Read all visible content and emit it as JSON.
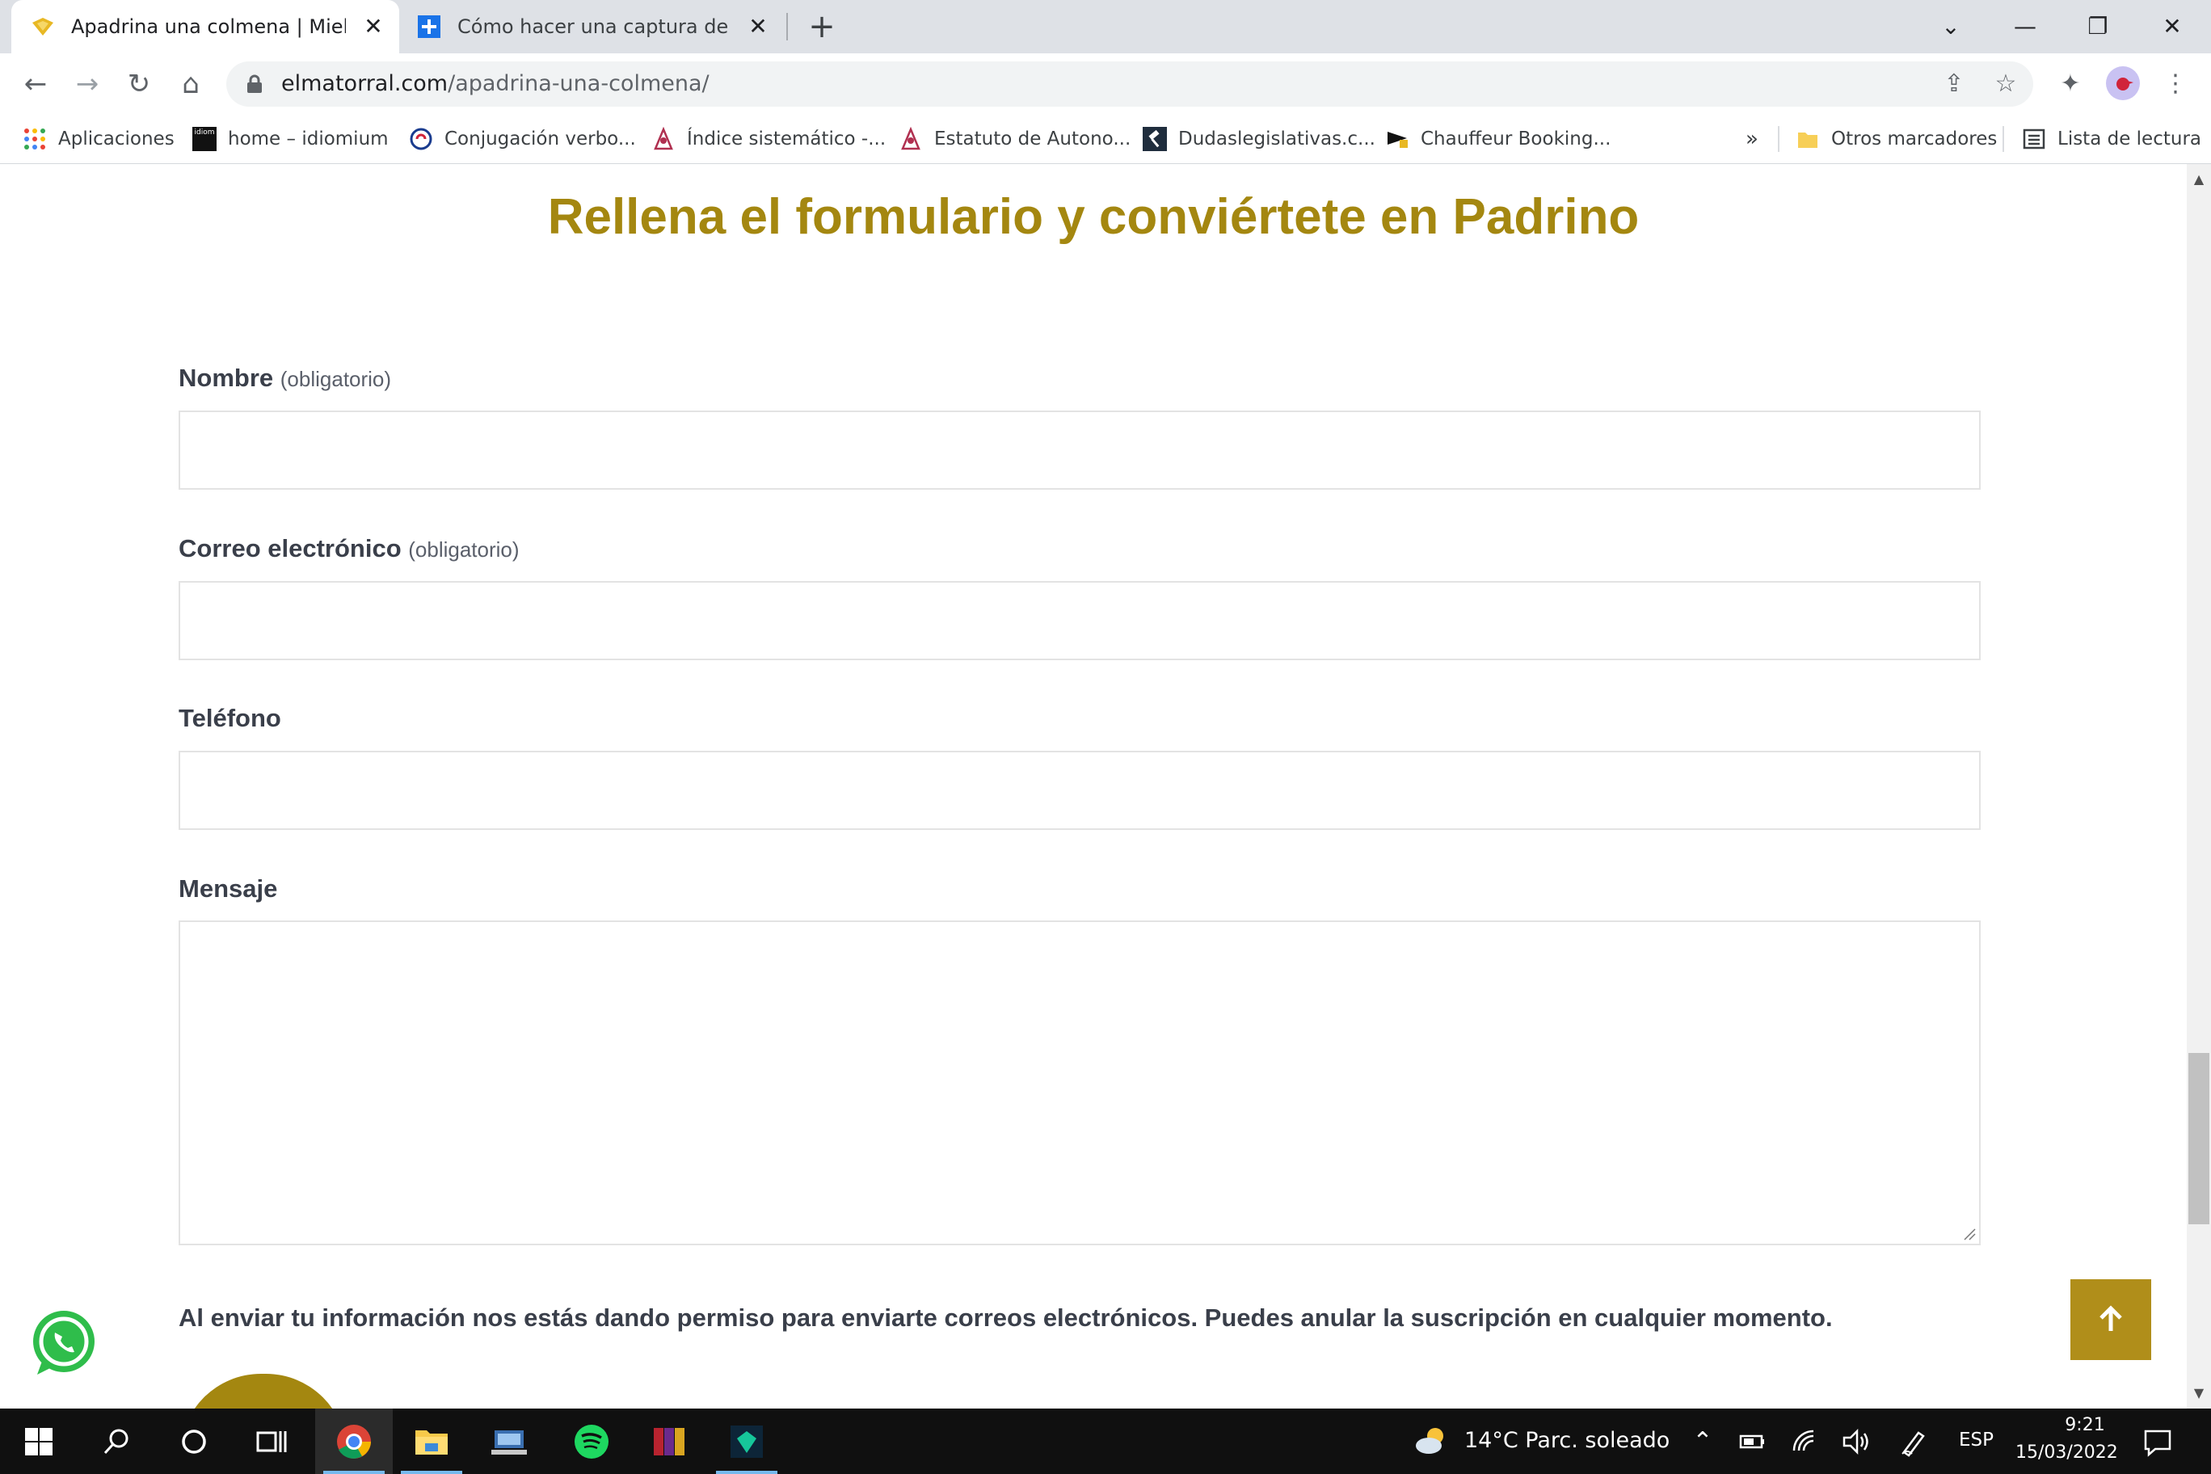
{
  "browser": {
    "tabs": [
      {
        "title": "Apadrina una colmena | Miel de Los Rabanales",
        "active": true
      },
      {
        "title": "Cómo hacer una captura de pantalla",
        "active": false
      }
    ],
    "url_host": "elmatorral.com",
    "url_path": "/apadrina-una-colmena/",
    "bookmarks": [
      {
        "label": "Aplicaciones"
      },
      {
        "label": "home – idiomium"
      },
      {
        "label": "Conjugación verbo..."
      },
      {
        "label": "Índice sistemático -..."
      },
      {
        "label": "Estatuto de Autono..."
      },
      {
        "label": "Dudaslegislativas.c..."
      },
      {
        "label": "Chauffeur Booking..."
      }
    ],
    "bookmarks_overflow": "»",
    "other_bookmarks": "Otros marcadores",
    "reading_list": "Lista de lectura"
  },
  "page": {
    "heading": "Rellena el formulario y conviértete en Padrino",
    "fields": [
      {
        "label": "Nombre",
        "required_text": "(obligatorio)",
        "value": ""
      },
      {
        "label": "Correo electrónico",
        "required_text": "(obligatorio)",
        "value": ""
      },
      {
        "label": "Teléfono",
        "required_text": "",
        "value": ""
      },
      {
        "label": "Mensaje",
        "required_text": "",
        "value": ""
      }
    ],
    "consent": "Al enviar tu información nos estás dando permiso para enviarte correos electrónicos. Puedes anular la suscripción en cualquier momento.",
    "accent": "#a48710"
  },
  "taskbar": {
    "weather": "14°C  Parc. soleado",
    "language": "ESP",
    "time": "9:21",
    "date": "15/03/2022"
  }
}
